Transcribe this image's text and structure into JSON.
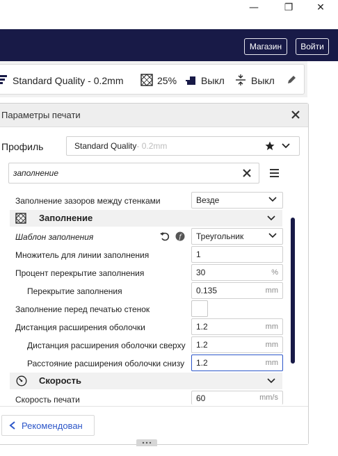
{
  "window": {
    "minimize_glyph": "—",
    "maximize_glyph": "❐",
    "close_glyph": "✕"
  },
  "header": {
    "store_label": "Магазин",
    "login_label": "Войти",
    "accent": "#181a47"
  },
  "quality_bar": {
    "profile": "Standard Quality - 0.2mm",
    "infill": "25%",
    "support": "Выкл",
    "adhesion": "Выкл"
  },
  "panel": {
    "title": "Параметры печати",
    "profile_label": "Профиль",
    "profile_name": "Standard Quality",
    "profile_suffix": " - 0.2mm",
    "search_value": "заполнение",
    "rows": {
      "gap_fill": {
        "label": "Заполнение зазоров между стенками",
        "value": "Везде"
      },
      "infill_section": "Заполнение",
      "pattern": {
        "label": "Шаблон заполнения",
        "value": "Треугольник"
      },
      "line_mult": {
        "label": "Множитель для линии заполнения",
        "value": "1"
      },
      "overlap_pct": {
        "label": "Процент перекрытие заполнения",
        "value": "30",
        "unit": "%"
      },
      "overlap": {
        "label": "Перекрытие заполнения",
        "value": "0.135",
        "unit": "mm"
      },
      "infill_before_walls": {
        "label": "Заполнение перед печатью стенок",
        "checked": false
      },
      "skin_expand": {
        "label": "Дистанция расширения оболочки",
        "value": "1.2",
        "unit": "mm"
      },
      "skin_expand_top": {
        "label": "Дистанция расширения оболочки сверху",
        "value": "1.2",
        "unit": "mm"
      },
      "skin_expand_bottom": {
        "label": "Расстояние расширения оболочки снизу",
        "value": "1.2",
        "unit": "mm"
      },
      "speed_section": "Скорость",
      "print_speed": {
        "label": "Скорость печати",
        "value": "60",
        "unit": "mm/s"
      }
    },
    "recommended_label": "Рекомендован"
  }
}
